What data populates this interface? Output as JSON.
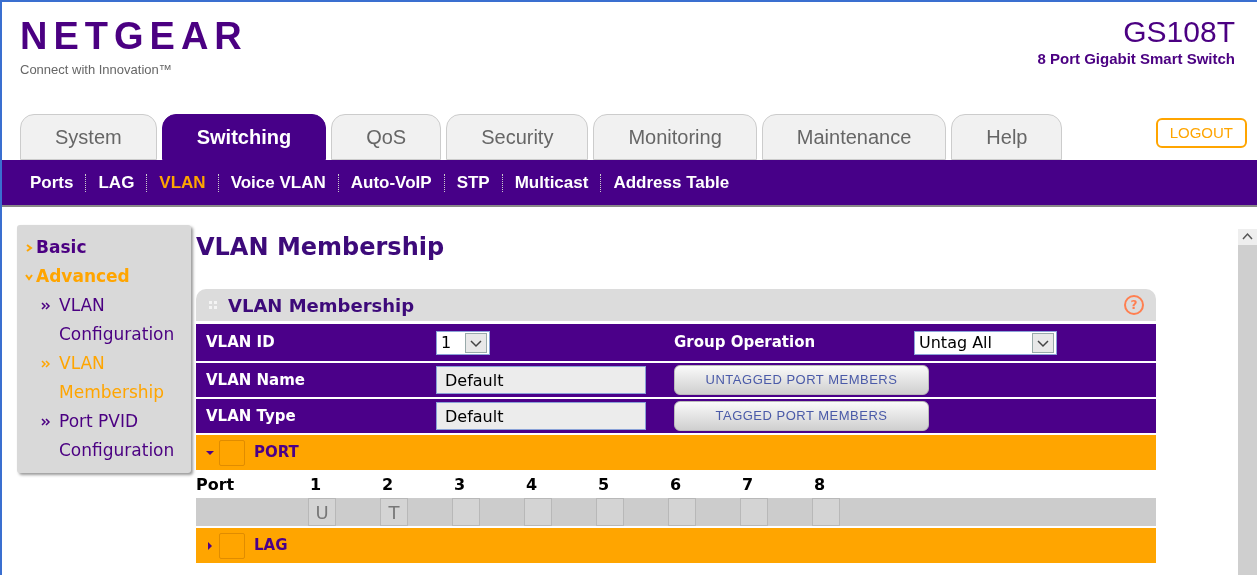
{
  "header": {
    "brand": "NETGEAR",
    "tagline": "Connect with Innovation™",
    "model": "GS108T",
    "model_subtitle": "8 Port Gigabit Smart Switch"
  },
  "tabs": [
    {
      "label": "System",
      "selected": false
    },
    {
      "label": "Switching",
      "selected": true
    },
    {
      "label": "QoS",
      "selected": false
    },
    {
      "label": "Security",
      "selected": false
    },
    {
      "label": "Monitoring",
      "selected": false
    },
    {
      "label": "Maintenance",
      "selected": false
    },
    {
      "label": "Help",
      "selected": false
    }
  ],
  "logout": "LOGOUT",
  "subnav": [
    {
      "label": "Ports",
      "selected": false
    },
    {
      "label": "LAG",
      "selected": false
    },
    {
      "label": "VLAN",
      "selected": true
    },
    {
      "label": "Voice VLAN",
      "selected": false
    },
    {
      "label": "Auto-VoIP",
      "selected": false
    },
    {
      "label": "STP",
      "selected": false
    },
    {
      "label": "Multicast",
      "selected": false
    },
    {
      "label": "Address Table",
      "selected": false
    }
  ],
  "sidebar": {
    "items": [
      {
        "label": "Basic",
        "expanded": false,
        "selected": false
      },
      {
        "label": "Advanced",
        "expanded": true,
        "selected": true,
        "children": [
          {
            "label": "VLAN Configuration",
            "selected": false
          },
          {
            "label": "VLAN Membership",
            "selected": true
          },
          {
            "label": "Port PVID Configuration",
            "selected": false
          }
        ]
      }
    ]
  },
  "page_title": "VLAN Membership",
  "panel": {
    "title": "VLAN Membership",
    "help": "?",
    "vlan_id": {
      "label": "VLAN ID",
      "value": "1"
    },
    "group_operation": {
      "label": "Group Operation",
      "value": "Untag All"
    },
    "vlan_name": {
      "label": "VLAN Name",
      "value": "Default"
    },
    "vlan_type": {
      "label": "VLAN Type",
      "value": "Default"
    },
    "buttons": [
      "UNTAGGED PORT MEMBERS",
      "TAGGED PORT MEMBERS"
    ],
    "sections": [
      {
        "label": "PORT",
        "expanded": true,
        "header": "Port",
        "ports": [
          {
            "number": "1",
            "value": "U"
          },
          {
            "number": "2",
            "value": "T"
          },
          {
            "number": "3"
          },
          {
            "number": "4"
          },
          {
            "number": "5"
          },
          {
            "number": "6"
          },
          {
            "number": "7"
          },
          {
            "number": "8"
          }
        ]
      },
      {
        "label": "LAG",
        "expanded": false
      }
    ]
  }
}
